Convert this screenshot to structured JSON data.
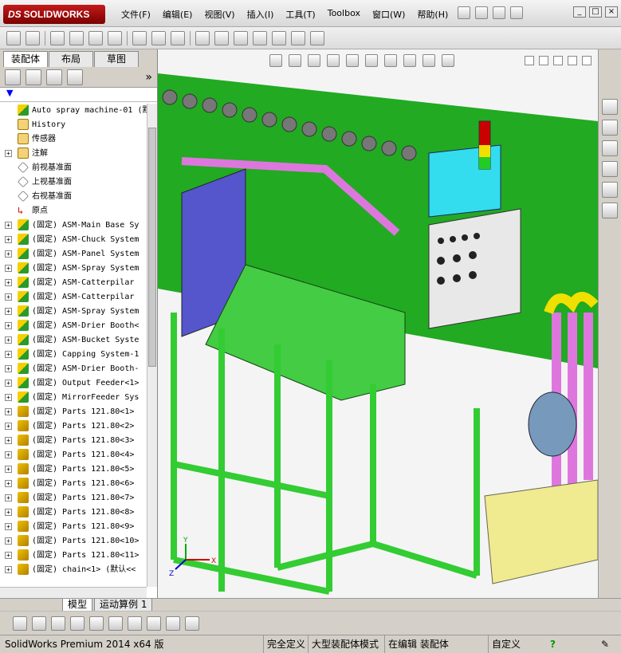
{
  "app": {
    "logo_text": "SOLIDWORKS",
    "logo_prefix": "DS"
  },
  "menu": [
    "文件(F)",
    "编辑(E)",
    "视图(V)",
    "插入(I)",
    "工具(T)",
    "Toolbox",
    "窗口(W)",
    "帮助(H)"
  ],
  "left_tabs": [
    "装配体",
    "布局",
    "草图"
  ],
  "tree": [
    {
      "expander": "",
      "icon": "asm",
      "text": "Auto spray machine-01  (默"
    },
    {
      "expander": "",
      "icon": "folder",
      "text": "History"
    },
    {
      "expander": "",
      "icon": "folder",
      "text": "传感器"
    },
    {
      "expander": "+",
      "icon": "folder",
      "text": "注解"
    },
    {
      "expander": "",
      "icon": "plane",
      "text": "前视基准面"
    },
    {
      "expander": "",
      "icon": "plane",
      "text": "上视基准面"
    },
    {
      "expander": "",
      "icon": "plane",
      "text": "右视基准面"
    },
    {
      "expander": "",
      "icon": "origin",
      "text": "原点"
    },
    {
      "expander": "+",
      "icon": "asm",
      "text": "(固定) ASM-Main Base Sy"
    },
    {
      "expander": "+",
      "icon": "asm",
      "text": "(固定) ASM-Chuck System"
    },
    {
      "expander": "+",
      "icon": "asm",
      "text": "(固定) ASM-Panel System"
    },
    {
      "expander": "+",
      "icon": "asm",
      "text": "(固定) ASM-Spray System"
    },
    {
      "expander": "+",
      "icon": "asm",
      "text": "(固定) ASM-Catterpilar"
    },
    {
      "expander": "+",
      "icon": "asm",
      "text": "(固定) ASM-Catterpilar"
    },
    {
      "expander": "+",
      "icon": "asm",
      "text": "(固定) ASM-Spray System"
    },
    {
      "expander": "+",
      "icon": "asm",
      "text": "(固定) ASM-Drier Booth<"
    },
    {
      "expander": "+",
      "icon": "asm",
      "text": "(固定) ASM-Bucket Syste"
    },
    {
      "expander": "+",
      "icon": "asm",
      "text": "(固定) Capping System-1"
    },
    {
      "expander": "+",
      "icon": "asm",
      "text": "(固定) ASM-Drier Booth-"
    },
    {
      "expander": "+",
      "icon": "asm",
      "text": "(固定) Output Feeder<1>"
    },
    {
      "expander": "+",
      "icon": "asm",
      "text": "(固定) MirrorFeeder Sys"
    },
    {
      "expander": "+",
      "icon": "part",
      "text": "(固定) Parts 121.80<1>"
    },
    {
      "expander": "+",
      "icon": "part",
      "text": "(固定) Parts 121.80<2>"
    },
    {
      "expander": "+",
      "icon": "part",
      "text": "(固定) Parts 121.80<3>"
    },
    {
      "expander": "+",
      "icon": "part",
      "text": "(固定) Parts 121.80<4>"
    },
    {
      "expander": "+",
      "icon": "part",
      "text": "(固定) Parts 121.80<5>"
    },
    {
      "expander": "+",
      "icon": "part",
      "text": "(固定) Parts 121.80<6>"
    },
    {
      "expander": "+",
      "icon": "part",
      "text": "(固定) Parts 121.80<7>"
    },
    {
      "expander": "+",
      "icon": "part",
      "text": "(固定) Parts 121.80<8>"
    },
    {
      "expander": "+",
      "icon": "part",
      "text": "(固定) Parts 121.80<9>"
    },
    {
      "expander": "+",
      "icon": "part",
      "text": "(固定) Parts 121.80<10>"
    },
    {
      "expander": "+",
      "icon": "part",
      "text": "(固定) Parts 121.80<11>"
    },
    {
      "expander": "+",
      "icon": "part",
      "text": "(固定) chain<1> (默认<<"
    }
  ],
  "bottom_tabs": [
    "模型",
    "运动算例 1"
  ],
  "status": {
    "product": "SolidWorks Premium 2014 x64 版",
    "defined": "完全定义",
    "mode": "大型装配体模式",
    "editing": "在编辑 装配体",
    "units": "自定义"
  },
  "triad": {
    "x": "X",
    "y": "Y",
    "z": "Z"
  },
  "colors": {
    "frame": "#33cc33",
    "tabletop": "#22aa22",
    "pipe": "#dd77dd",
    "yellow": "#f0e000",
    "cyan": "#33ddee",
    "panel": "#e8e8e8"
  }
}
